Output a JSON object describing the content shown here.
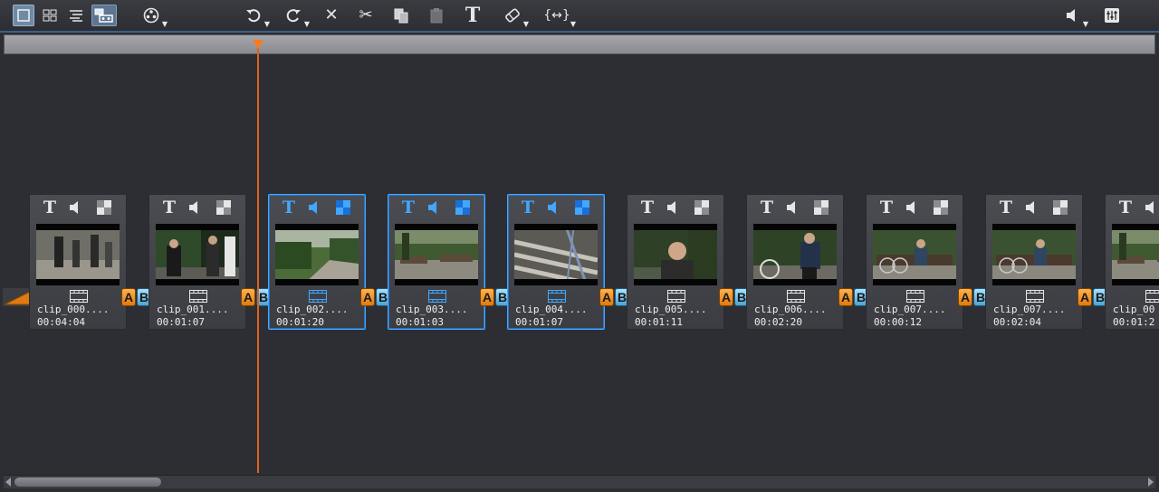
{
  "toolbar": {
    "left": [
      {
        "name": "single-view-button",
        "icon": "single-view-icon",
        "state": "active"
      },
      {
        "name": "grid-view-button",
        "icon": "grid-view-icon"
      },
      {
        "name": "list-view-button",
        "icon": "list-view-icon"
      },
      {
        "name": "storyboard-view-button",
        "icon": "storyboard-icon",
        "state": "pressed"
      },
      {
        "name": "effects-menu-button",
        "icon": "film-reel-icon",
        "dropdown": true
      }
    ],
    "middle": [
      {
        "name": "undo-button",
        "icon": "undo-icon",
        "dropdown": true
      },
      {
        "name": "redo-button",
        "icon": "redo-icon",
        "dropdown": true
      },
      {
        "name": "delete-button",
        "icon": "close-icon",
        "glyph": "✕"
      },
      {
        "name": "cut-button",
        "icon": "scissors-icon",
        "glyph": "✂"
      },
      {
        "name": "copy-button",
        "icon": "copy-icon"
      },
      {
        "name": "paste-button",
        "icon": "paste-icon",
        "disabled": true
      },
      {
        "name": "title-button",
        "icon": "text-icon",
        "glyph": "T"
      },
      {
        "name": "marker-button",
        "icon": "eraser-icon",
        "dropdown": true
      },
      {
        "name": "code-button",
        "icon": "brackets-icon",
        "glyph": "{↔}",
        "dropdown": true
      }
    ],
    "right": [
      {
        "name": "volume-button",
        "icon": "speaker-icon",
        "dropdown": true
      },
      {
        "name": "mixer-button",
        "icon": "mixer-icon"
      }
    ]
  },
  "clips": [
    {
      "name": "clip_000....",
      "duration": "00:04:04",
      "selected": false,
      "scene": "street-crowd"
    },
    {
      "name": "clip_001....",
      "duration": "00:01:07",
      "selected": false,
      "scene": "men-walking"
    },
    {
      "name": "clip_002....",
      "duration": "00:01:20",
      "selected": true,
      "scene": "park-path"
    },
    {
      "name": "clip_003....",
      "duration": "00:01:03",
      "selected": true,
      "scene": "park-benches"
    },
    {
      "name": "clip_004....",
      "duration": "00:01:07",
      "selected": true,
      "scene": "bench-closeup"
    },
    {
      "name": "clip_005....",
      "duration": "00:01:11",
      "selected": false,
      "scene": "man-portrait"
    },
    {
      "name": "clip_006....",
      "duration": "00:02:20",
      "selected": false,
      "scene": "man-bike"
    },
    {
      "name": "clip_007....",
      "duration": "00:00:12",
      "selected": false,
      "scene": "man-sitting"
    },
    {
      "name": "clip_007....",
      "duration": "00:02:04",
      "selected": false,
      "scene": "man-sitting"
    },
    {
      "name": "clip_00",
      "duration": "00:01:2",
      "selected": false,
      "scene": "park-benches"
    }
  ],
  "transition": {
    "a_label": "A",
    "b_label": "B"
  },
  "colors": {
    "accent_select": "#4aa4ff",
    "playhead": "#ff7a1a",
    "transition_a": "#e07a10",
    "transition_b": "#4ba4d4"
  }
}
